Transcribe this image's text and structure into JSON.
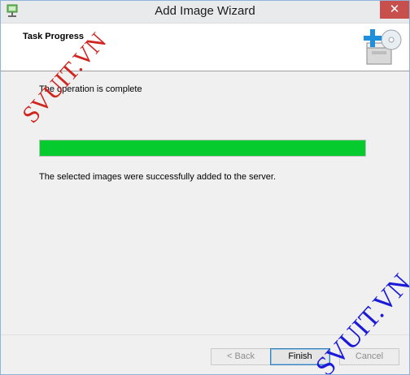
{
  "window": {
    "title": "Add Image Wizard",
    "close_glyph": "✕"
  },
  "header": {
    "title": "Task Progress",
    "icon": "add-image-icon"
  },
  "content": {
    "status_text": "The operation is complete",
    "progress_fraction": 1.0,
    "progress_color": "#06cb2e",
    "result_text": "The selected images were successfully added to the server."
  },
  "buttons": {
    "back": "< Back",
    "finish": "Finish",
    "cancel": "Cancel"
  },
  "watermarks": {
    "red": "SVUIT.VN",
    "blue": "SVUIT.VN"
  }
}
